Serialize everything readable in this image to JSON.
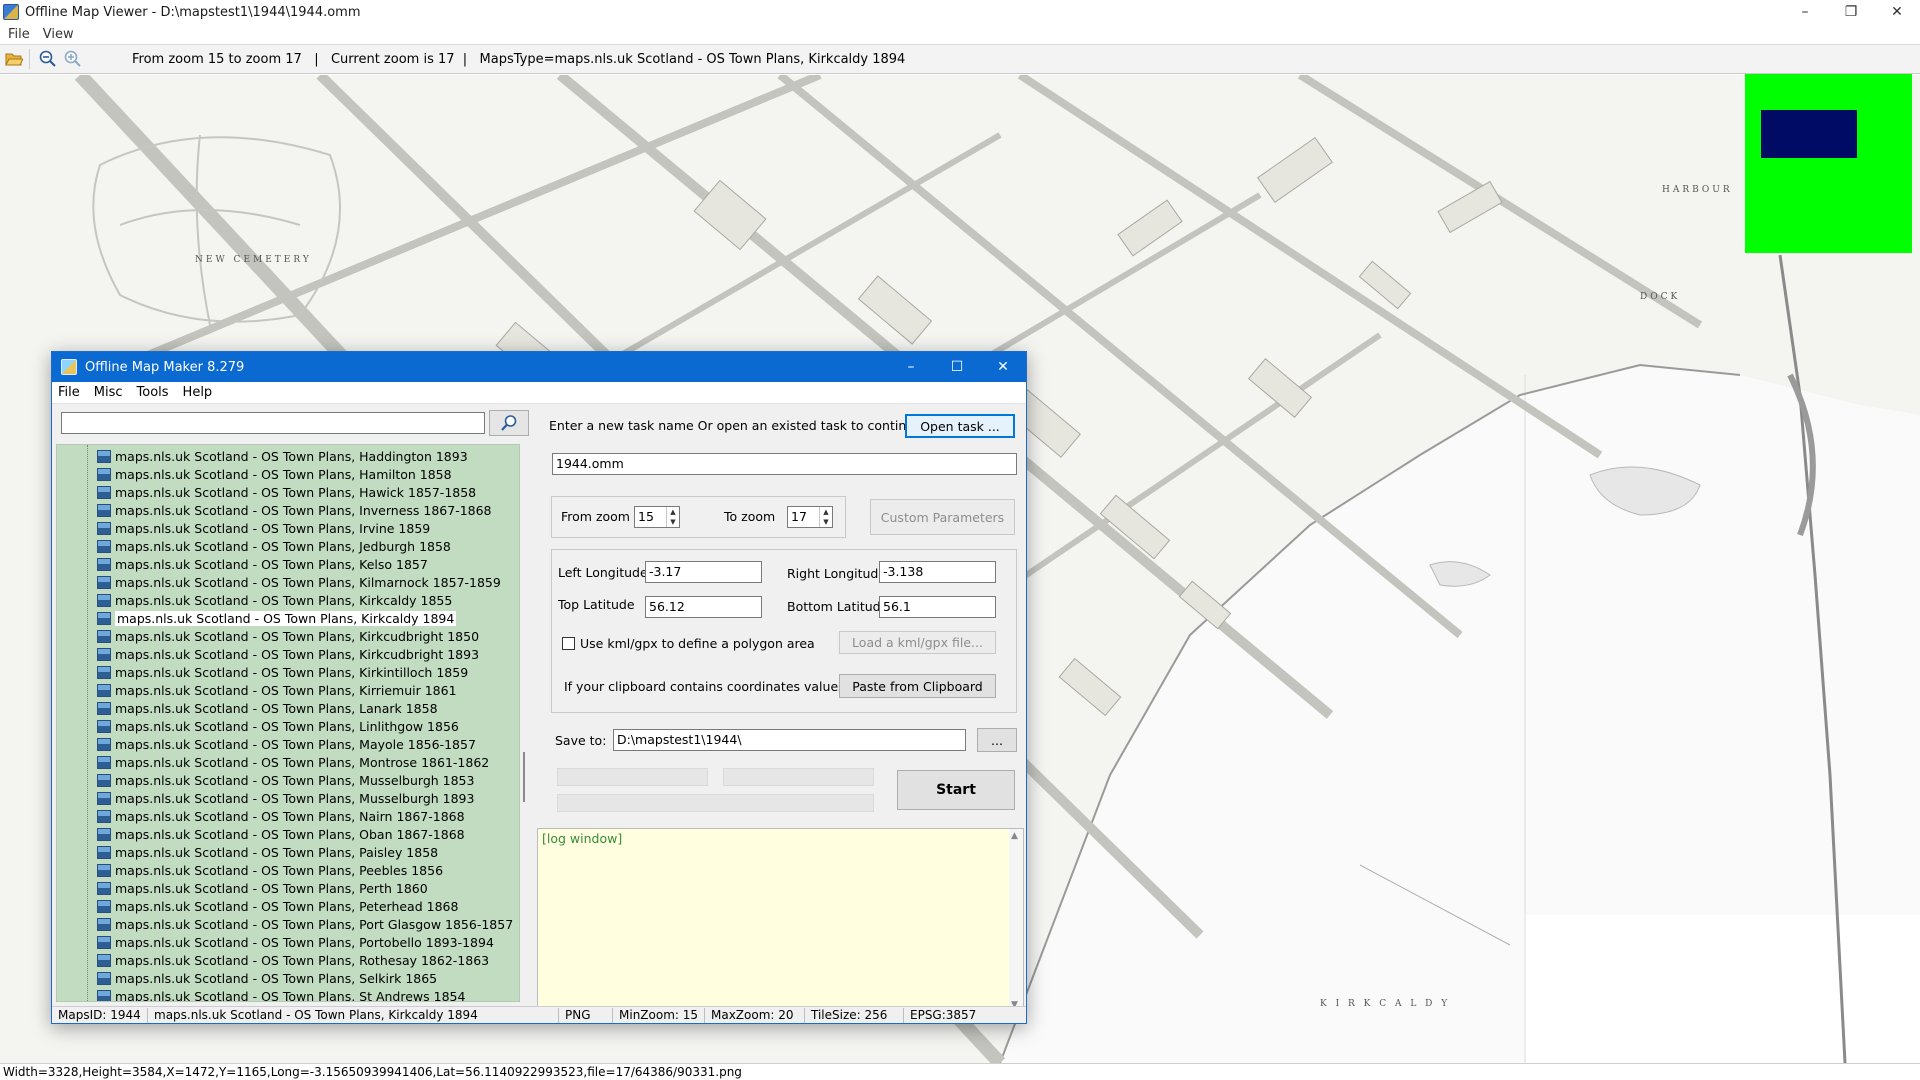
{
  "viewer": {
    "title": "Offline Map Viewer - D:\\mapstest1\\1944\\1944.omm",
    "menu": [
      "File",
      "View"
    ],
    "toolbar_info": "From zoom 15 to zoom 17   |   Current zoom is 17  |   MapsType=maps.nls.uk Scotland - OS Town Plans, Kirkcaldy 1894",
    "icons": {
      "open": "folder-open-icon",
      "zoom_out": "zoom-out-icon",
      "zoom_in": "zoom-in-icon"
    },
    "map_labels": {
      "cemetery": "NEW CEMETERY",
      "harbour": "HARBOUR",
      "dock": "DOCK",
      "town": "K I R K C A L D Y"
    },
    "status": "Width=3328,Height=3584,X=1472,Y=1165,Long=-3.15650939941406,Lat=56.1140922993523,file=17/64386/90331.png",
    "overview_colors": {
      "background": "#00ff00",
      "viewport": "#000b66"
    }
  },
  "dialog": {
    "title": "Offline Map Maker 8.279",
    "menu": [
      "File",
      "Misc",
      "Tools",
      "Help"
    ],
    "search": {
      "value": "",
      "placeholder": ""
    },
    "tree_items": [
      "maps.nls.uk Scotland - OS Town Plans, Haddington 1893",
      "maps.nls.uk Scotland - OS Town Plans, Hamilton 1858",
      "maps.nls.uk Scotland - OS Town Plans, Hawick 1857-1858",
      "maps.nls.uk Scotland - OS Town Plans, Inverness 1867-1868",
      "maps.nls.uk Scotland - OS Town Plans, Irvine 1859",
      "maps.nls.uk Scotland - OS Town Plans, Jedburgh 1858",
      "maps.nls.uk Scotland - OS Town Plans, Kelso 1857",
      "maps.nls.uk Scotland - OS Town Plans, Kilmarnock 1857-1859",
      "maps.nls.uk Scotland - OS Town Plans, Kirkcaldy 1855",
      "maps.nls.uk Scotland - OS Town Plans, Kirkcaldy 1894",
      "maps.nls.uk Scotland - OS Town Plans, Kirkcudbright 1850",
      "maps.nls.uk Scotland - OS Town Plans, Kirkcudbright 1893",
      "maps.nls.uk Scotland - OS Town Plans, Kirkintilloch 1859",
      "maps.nls.uk Scotland - OS Town Plans, Kirriemuir 1861",
      "maps.nls.uk Scotland - OS Town Plans, Lanark 1858",
      "maps.nls.uk Scotland - OS Town Plans, Linlithgow 1856",
      "maps.nls.uk Scotland - OS Town Plans, Mayole 1856-1857",
      "maps.nls.uk Scotland - OS Town Plans, Montrose 1861-1862",
      "maps.nls.uk Scotland - OS Town Plans, Musselburgh 1853",
      "maps.nls.uk Scotland - OS Town Plans, Musselburgh 1893",
      "maps.nls.uk Scotland - OS Town Plans, Nairn 1867-1868",
      "maps.nls.uk Scotland - OS Town Plans, Oban 1867-1868",
      "maps.nls.uk Scotland - OS Town Plans, Paisley 1858",
      "maps.nls.uk Scotland - OS Town Plans, Peebles 1856",
      "maps.nls.uk Scotland - OS Town Plans, Perth 1860",
      "maps.nls.uk Scotland - OS Town Plans, Peterhead 1868",
      "maps.nls.uk Scotland - OS Town Plans, Port Glasgow 1856-1857",
      "maps.nls.uk Scotland - OS Town Plans, Portobello 1893-1894",
      "maps.nls.uk Scotland - OS Town Plans, Rothesay 1862-1863",
      "maps.nls.uk Scotland - OS Town Plans, Selkirk 1865",
      "maps.nls.uk Scotland - OS Town Plans, St Andrews 1854"
    ],
    "selected_item": "maps.nls.uk Scotland - OS Town Plans, Kirkcaldy 1894",
    "task_prompt": "Enter a new task name Or open an existed task to continue:",
    "open_task_label": "Open task ...",
    "task_name": "1944.omm",
    "from_zoom_label": "From zoom",
    "from_zoom": "15",
    "to_zoom_label": "To zoom",
    "to_zoom": "17",
    "custom_params_label": "Custom Parameters",
    "left_lon_label": "Left Longitude",
    "left_lon": "-3.17",
    "right_lon_label": "Right Longitude",
    "right_lon": "-3.138",
    "top_lat_label": "Top Latitude",
    "top_lat": "56.12",
    "bottom_lat_label": "Bottom Latitude",
    "bottom_lat": "56.1",
    "kml_label": "Use kml/gpx to define a polygon area",
    "load_kml_label": "Load a kml/gpx file...",
    "clipboard_prompt": "If your clipboard contains coordinates values:",
    "paste_label": "Paste from Clipboard",
    "save_to_label": "Save to:",
    "save_to": "D:\\mapstest1\\1944\\",
    "browse_label": "...",
    "start_label": "Start",
    "log_text": "[log window]",
    "status": {
      "maps_id": "MapsID: 1944",
      "maps_name": "maps.nls.uk Scotland - OS Town Plans, Kirkcaldy 1894",
      "format": "PNG",
      "min_zoom": "MinZoom: 15",
      "max_zoom": "MaxZoom: 20",
      "tile_size": "TileSize: 256",
      "epsg": "EPSG:3857"
    }
  }
}
